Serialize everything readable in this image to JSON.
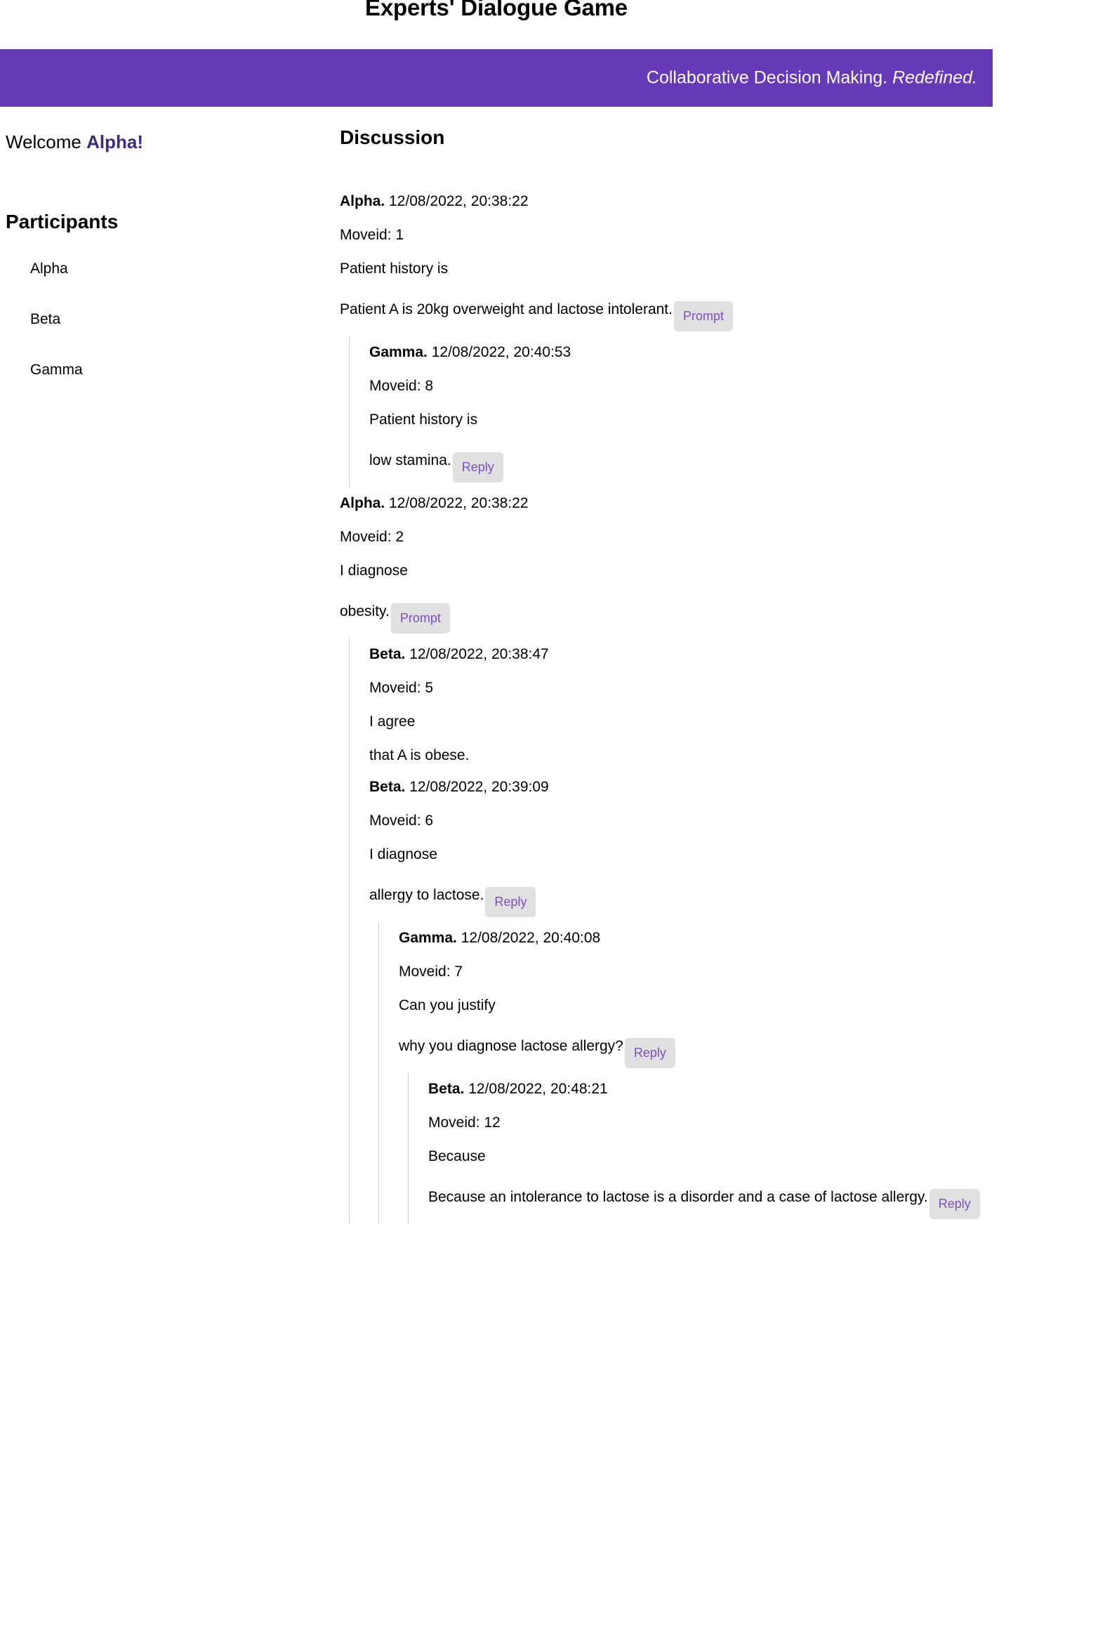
{
  "page": {
    "title": "Experts' Dialogue Game",
    "banner": {
      "text_plain": "Collaborative Decision Making.",
      "text_italic": "Redefined.",
      "background_color": "#6639b7",
      "text_color": "#ffffff"
    }
  },
  "sidebar": {
    "welcome_prefix": "Welcome ",
    "welcome_user": "Alpha!",
    "welcome_user_color": "#3f2a7e",
    "participants_title": "Participants",
    "participants": [
      {
        "name": "Alpha"
      },
      {
        "name": "Beta"
      },
      {
        "name": "Gamma"
      }
    ]
  },
  "discussion": {
    "title": "Discussion",
    "button_colors": {
      "background": "#e0e0e0",
      "text": "#7c4fc4"
    },
    "messages": [
      {
        "author": "Alpha.",
        "timestamp": "12/08/2022, 20:38:22",
        "moveid_label": "Moveid: 1",
        "line1": "Patient history is",
        "line2": "Patient A is 20kg overweight and lactose intolerant.",
        "button": "Prompt",
        "replies": [
          {
            "author": "Gamma.",
            "timestamp": "12/08/2022, 20:40:53",
            "moveid_label": "Moveid: 8",
            "line1": "Patient history is",
            "line2": "low stamina.",
            "button": "Reply",
            "replies": []
          }
        ]
      },
      {
        "author": "Alpha.",
        "timestamp": "12/08/2022, 20:38:22",
        "moveid_label": "Moveid: 2",
        "line1": "I diagnose",
        "line2": "obesity.",
        "button": "Prompt",
        "replies": [
          {
            "author": "Beta.",
            "timestamp": "12/08/2022, 20:38:47",
            "moveid_label": "Moveid: 5",
            "line1": "I agree",
            "line2": "that A is obese.",
            "button": null,
            "replies": []
          },
          {
            "author": "Beta.",
            "timestamp": "12/08/2022, 20:39:09",
            "moveid_label": "Moveid: 6",
            "line1": "I diagnose",
            "line2": "allergy to lactose.",
            "button": "Reply",
            "replies": [
              {
                "author": "Gamma.",
                "timestamp": "12/08/2022, 20:40:08",
                "moveid_label": "Moveid: 7",
                "line1": "Can you justify",
                "line2": "why you diagnose lactose allergy?",
                "button": "Reply",
                "replies": [
                  {
                    "author": "Beta.",
                    "timestamp": "12/08/2022, 20:48:21",
                    "moveid_label": "Moveid: 12",
                    "line1": "Because",
                    "line2": "Because an intolerance to lactose is a disorder and a case of lactose allergy.",
                    "button": "Reply",
                    "replies": []
                  }
                ]
              }
            ]
          }
        ]
      }
    ]
  }
}
